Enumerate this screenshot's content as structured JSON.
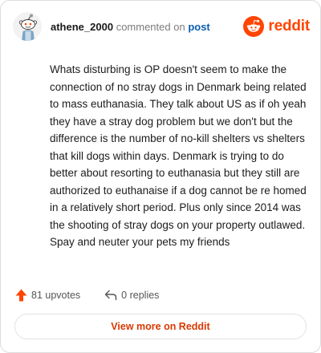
{
  "header": {
    "username": "athene_2000",
    "verb": "commented on",
    "post_link": "post",
    "brand": "reddit"
  },
  "comment": {
    "text": "Whats disturbing is OP doesn't seem to make the connection of no stray dogs in Denmark being related to mass euthanasia. They talk about US as if oh yeah they have a stray dog problem but we don't but the difference is the number of no-kill shelters vs shelters that kill dogs within days. Denmark is trying to do better about resorting to euthanasia but they still are authorized to euthanaise if a dog cannot be re homed in a relatively short period. Plus only since 2014 was the shooting of stray dogs on your property outlawed. Spay and neuter your pets my friends"
  },
  "footer": {
    "upvotes": "81 upvotes",
    "replies": "0 replies",
    "upvote_icon": "upvote-arrow-icon",
    "reply_icon": "reply-arrow-icon"
  },
  "actions": {
    "view_more": "View more on Reddit"
  },
  "colors": {
    "brand": "#ff4500",
    "link": "#0b5fb0",
    "button_text": "#d93900"
  }
}
